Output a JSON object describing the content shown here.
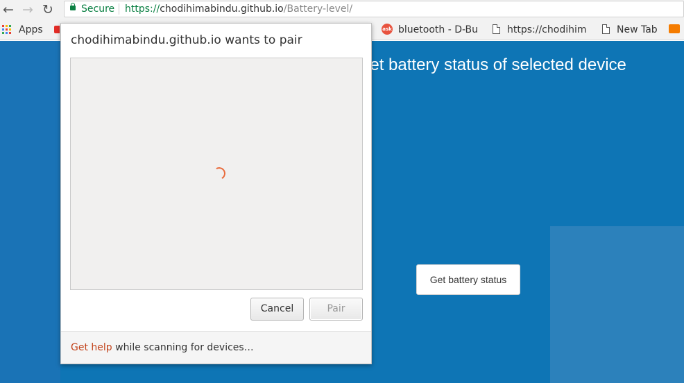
{
  "toolbar": {
    "back_icon": "arrow-left-icon",
    "forward_icon": "arrow-right-icon",
    "reload_icon": "reload-icon",
    "secure_label": "Secure",
    "url_scheme": "https://",
    "url_domain": "chodihimabindu.github.io",
    "url_path": "/Battery-level/"
  },
  "bookmarks": {
    "apps_label": "Apps",
    "items": [
      {
        "label": "bluetooth - D-Bu",
        "icon": "ask-icon"
      },
      {
        "label": "https://chodihim",
        "icon": "page-icon"
      },
      {
        "label": "New Tab",
        "icon": "page-icon"
      }
    ],
    "ask_badge": "ask"
  },
  "page": {
    "heading": "o get battery status of selected device",
    "button_label": "Get battery status"
  },
  "dialog": {
    "title": "chodihimabindu.github.io wants to pair",
    "cancel_label": "Cancel",
    "pair_label": "Pair",
    "footer_link": "Get help",
    "footer_text": " while scanning for devices…"
  },
  "colors": {
    "page_bg": "#0e75b5",
    "secure_green": "#0b8043",
    "spinner": "#e96b3c",
    "help_link": "#c2431b"
  }
}
